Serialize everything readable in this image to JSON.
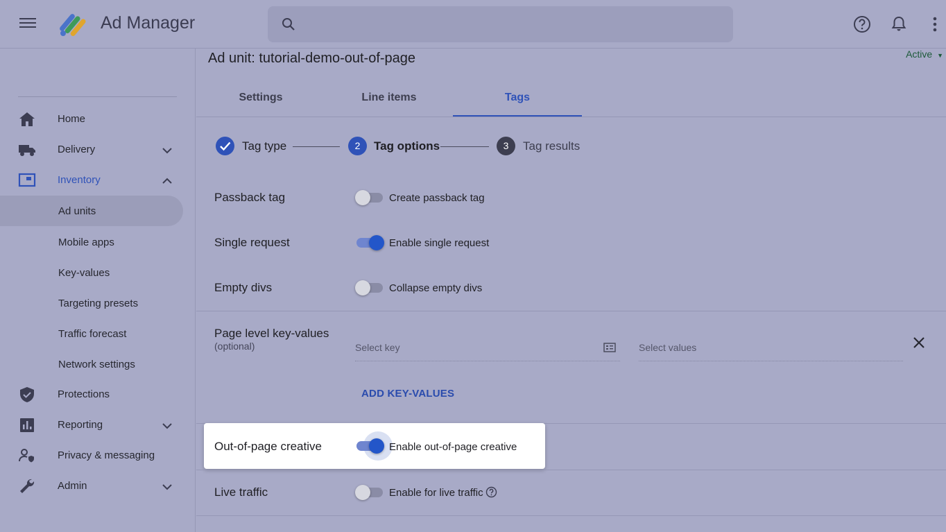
{
  "header": {
    "app_title": "Ad Manager",
    "search_placeholder": ""
  },
  "sidebar": {
    "items": [
      {
        "label": "Home",
        "icon": "home-icon"
      },
      {
        "label": "Delivery",
        "icon": "truck-icon"
      },
      {
        "label": "Inventory",
        "icon": "inventory-icon"
      },
      {
        "label": "Protections",
        "icon": "shield-icon"
      },
      {
        "label": "Reporting",
        "icon": "bar-chart-icon"
      },
      {
        "label": "Privacy & messaging",
        "icon": "person-shield-icon"
      },
      {
        "label": "Admin",
        "icon": "wrench-icon"
      }
    ],
    "inventory_sub": [
      {
        "label": "Ad units",
        "selected": true
      },
      {
        "label": "Mobile apps"
      },
      {
        "label": "Key-values"
      },
      {
        "label": "Targeting presets"
      },
      {
        "label": "Traffic forecast"
      },
      {
        "label": "Network settings"
      }
    ]
  },
  "main": {
    "page_title": "Ad unit: tutorial-demo-out-of-page",
    "status": "Active",
    "tabs": [
      {
        "label": "Settings"
      },
      {
        "label": "Line items"
      },
      {
        "label": "Tags",
        "active": true
      }
    ],
    "steps": [
      {
        "number": "",
        "label": "Tag type",
        "state": "done"
      },
      {
        "number": "2",
        "label": "Tag options",
        "state": "current"
      },
      {
        "number": "3",
        "label": "Tag results",
        "state": "pending"
      }
    ],
    "options": {
      "passback": {
        "label": "Passback tag",
        "toggle_text": "Create passback tag",
        "on": false
      },
      "single_request": {
        "label": "Single request",
        "toggle_text": "Enable single request",
        "on": true
      },
      "empty_divs": {
        "label": "Empty divs",
        "toggle_text": "Collapse empty divs",
        "on": false
      },
      "out_of_page": {
        "label": "Out-of-page creative",
        "toggle_text": "Enable out-of-page creative",
        "on": true
      },
      "live_traffic": {
        "label": "Live traffic",
        "toggle_text": "Enable for live traffic",
        "on": false
      }
    },
    "key_values": {
      "label": "Page level key-values",
      "optional": "(optional)",
      "key_placeholder": "Select key",
      "values_placeholder": "Select values",
      "add_button": "ADD KEY-VALUES"
    }
  },
  "colors": {
    "accent": "#2f52b8",
    "background": "#a8aac7",
    "toggle_on": "#2356c9",
    "status_active": "#1d5a3a"
  }
}
